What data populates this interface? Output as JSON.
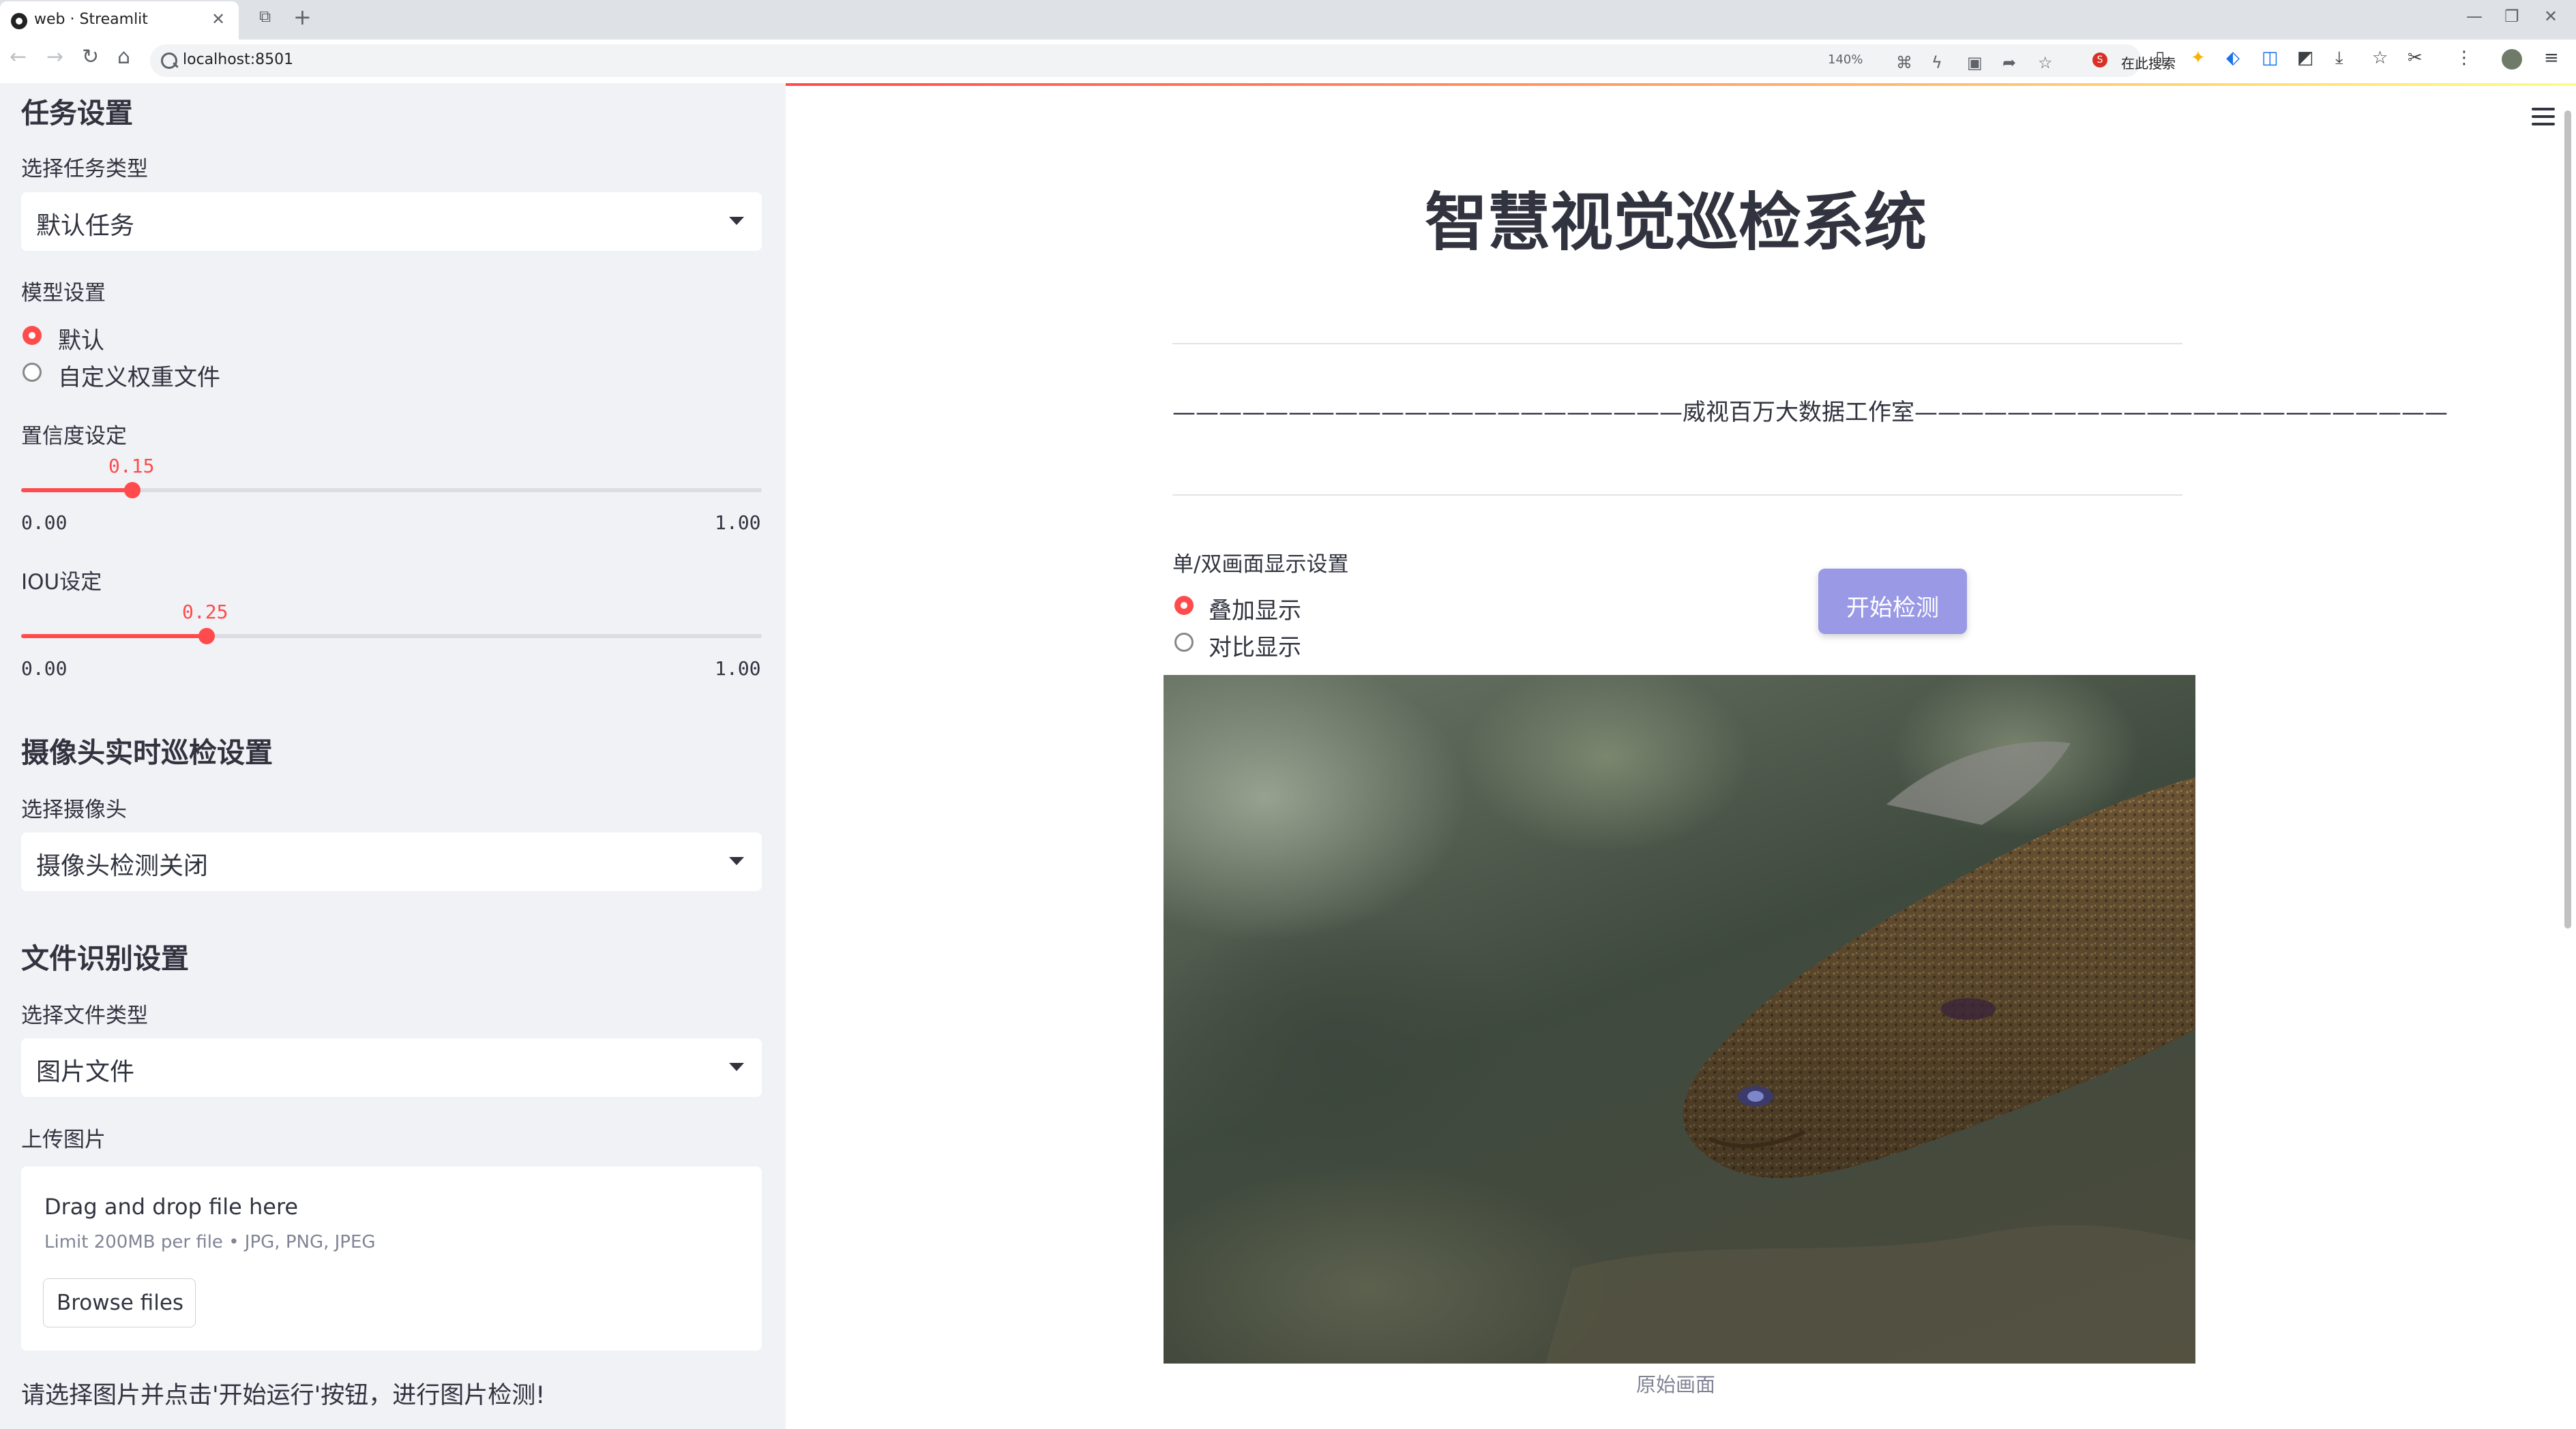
{
  "browser": {
    "tab_title": "web · Streamlit",
    "url": "localhost:8501",
    "zoom": "140%",
    "search_engine_label": "在此搜索"
  },
  "sidebar": {
    "task_section_title": "任务设置",
    "task_type_label": "选择任务类型",
    "task_type_value": "默认任务",
    "model_label": "模型设置",
    "model_options": [
      "默认",
      "自定义权重文件"
    ],
    "model_selected": 0,
    "confidence": {
      "label": "置信度设定",
      "value": "0.15",
      "min": "0.00",
      "max": "1.00",
      "fraction": 0.15
    },
    "iou": {
      "label": "IOU设定",
      "value": "0.25",
      "min": "0.00",
      "max": "1.00",
      "fraction": 0.25
    },
    "camera_section_title": "摄像头实时巡检设置",
    "camera_label": "选择摄像头",
    "camera_value": "摄像头检测关闭",
    "file_section_title": "文件识别设置",
    "file_type_label": "选择文件类型",
    "file_type_value": "图片文件",
    "upload_label": "上传图片",
    "uploader": {
      "drop_text": "Drag and drop file here",
      "limit_text": "Limit 200MB per file • JPG, PNG, JPEG",
      "browse_label": "Browse files"
    },
    "hint": "请选择图片并点击'开始运行'按钮，进行图片检测!"
  },
  "main": {
    "title": "智慧视觉巡检系统",
    "studio_line": "——————————————————————威视百万大数据工作室———————————————————————",
    "view_mode_label": "单/双画面显示设置",
    "view_options": [
      "叠加显示",
      "对比显示"
    ],
    "view_selected": 0,
    "start_button": "开始检测",
    "image_caption": "原始画面"
  },
  "colors": {
    "accent": "#ff4b4b",
    "sidebar_bg": "#f0f2f6",
    "button": "#9a99e6",
    "text": "#31333f"
  }
}
